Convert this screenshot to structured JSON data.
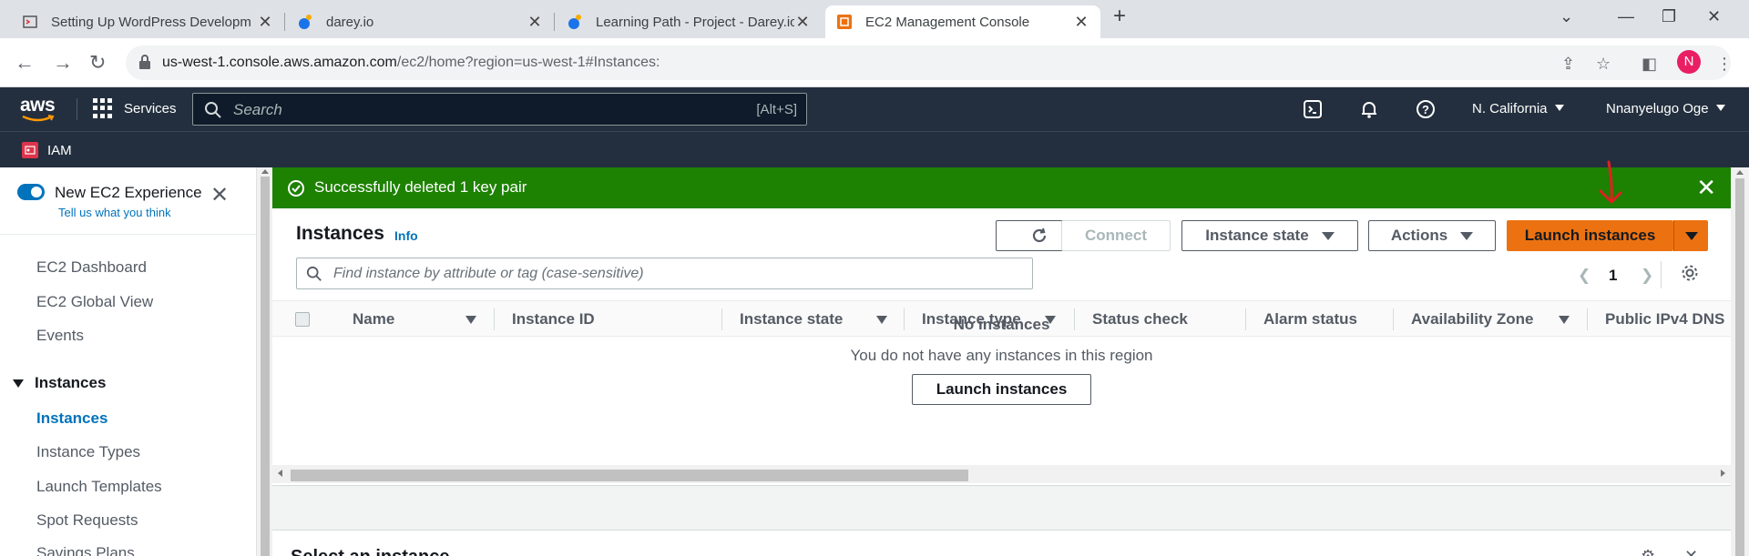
{
  "browser": {
    "tabs": [
      {
        "title": "Setting Up WordPress Developm",
        "active": false
      },
      {
        "title": "darey.io",
        "active": false
      },
      {
        "title": "Learning Path - Project - Darey.io",
        "active": false
      },
      {
        "title": "EC2 Management Console",
        "active": true
      }
    ],
    "url_host": "us-west-1.console.aws.amazon.com",
    "url_path": "/ec2/home?region=us-west-1#Instances:",
    "profile_initial": "N"
  },
  "aws_header": {
    "logo": "aws",
    "services_label": "Services",
    "search_placeholder": "Search",
    "search_shortcut": "[Alt+S]",
    "region": "N. California",
    "user": "Nnanyelugo Oge",
    "favorite": "IAM"
  },
  "sidebar": {
    "toggle_label": "New EC2 Experience",
    "toggle_sub": "Tell us what you think",
    "items": [
      "EC2 Dashboard",
      "EC2 Global View",
      "Events"
    ],
    "section": "Instances",
    "section_items": [
      {
        "label": "Instances",
        "active": true
      },
      {
        "label": "Instance Types",
        "active": false
      },
      {
        "label": "Launch Templates",
        "active": false
      },
      {
        "label": "Spot Requests",
        "active": false
      },
      {
        "label": "Savings Plans",
        "active": false
      }
    ]
  },
  "flash": {
    "message": "Successfully deleted 1 key pair",
    "status_color": "#1d8102"
  },
  "instances_panel": {
    "title": "Instances",
    "info": "Info",
    "connect_label": "Connect",
    "instance_state_label": "Instance state",
    "actions_label": "Actions",
    "launch_label": "Launch instances",
    "filter_placeholder": "Find instance by attribute or tag (case-sensitive)",
    "page": "1",
    "columns": [
      "Name",
      "Instance ID",
      "Instance state",
      "Instance type",
      "Status check",
      "Alarm status",
      "Availability Zone",
      "Public IPv4 DNS"
    ],
    "empty_title": "No instances",
    "empty_sub": "You do not have any instances in this region",
    "empty_button": "Launch instances",
    "accent_color": "#ec7211"
  },
  "lower_panel": {
    "title": "Select an instance"
  }
}
